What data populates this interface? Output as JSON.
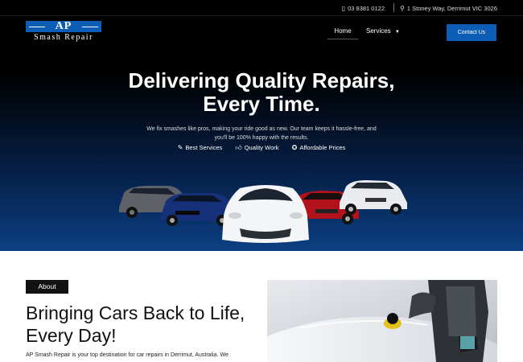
{
  "topbar": {
    "phone": "03 8381 0122",
    "address": "1 Stoney Way, Derrimut VIC 3026"
  },
  "logo": {
    "main": "AP",
    "sub": "Smash Repair"
  },
  "nav": {
    "home": "Home",
    "services": "Services",
    "contact": "Contact Us"
  },
  "hero": {
    "title_line1": "Delivering Quality Repairs,",
    "title_line2": "Every Time.",
    "desc": "We fix smashes like pros, making your ride good as new. Our team keeps it hassle-free, and you'll be 100% happy with the results.",
    "features": [
      "Best Services",
      "Quality Work",
      "Affordable Prices"
    ]
  },
  "about": {
    "tag": "About",
    "title": "Bringing Cars Back to Life, Every Day!",
    "text": "AP Smash Repair is your top destination for car repairs in Derrimut, Australia. We"
  },
  "colors": {
    "brand": "#0b5db5",
    "hero_bottom": "#0c3f82",
    "dark": "#000000"
  },
  "icons": [
    "phone-icon",
    "location-icon",
    "chevron-down-icon",
    "wrench-icon",
    "thumbs-up-icon",
    "price-tag-icon"
  ]
}
